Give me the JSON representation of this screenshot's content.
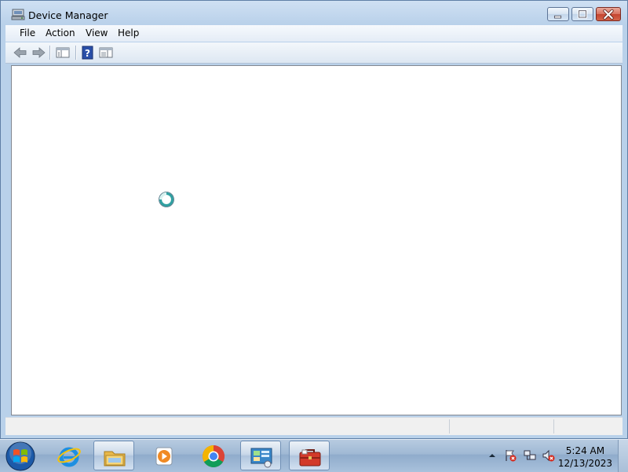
{
  "window": {
    "title": "Device Manager",
    "icon": "device-manager-icon",
    "caption_buttons": [
      "minimize-icon",
      "maximize-icon",
      "close-icon"
    ]
  },
  "menu": {
    "items": [
      {
        "label": "File"
      },
      {
        "label": "Action"
      },
      {
        "label": "View"
      },
      {
        "label": "Help"
      }
    ]
  },
  "toolbar": {
    "buttons": [
      {
        "icon": "back-arrow-icon"
      },
      {
        "icon": "forward-arrow-icon"
      },
      {
        "icon": "show-hide-console-tree-icon"
      },
      {
        "icon": "help-icon"
      },
      {
        "icon": "properties-pane-icon"
      }
    ]
  },
  "content": {
    "cursor": "busy-cursor-icon"
  },
  "taskbar": {
    "pinned": [
      {
        "icon": "internet-explorer-icon"
      },
      {
        "icon": "file-explorer-icon"
      },
      {
        "icon": "media-player-icon"
      },
      {
        "icon": "chrome-icon"
      },
      {
        "icon": "control-panel-icon"
      },
      {
        "icon": "toolbox-icon"
      }
    ],
    "tray": {
      "icons": [
        "show-hidden-icons-arrow",
        "action-center-error-icon",
        "network-icon",
        "volume-muted-icon"
      ],
      "time": "5:24 AM",
      "date": "12/13/2023"
    }
  },
  "colors": {
    "window_frame": "#b9d1ea",
    "close_button": "#c44530",
    "taskbar": "#9fb8d4",
    "content_bg": "#ffffff"
  }
}
